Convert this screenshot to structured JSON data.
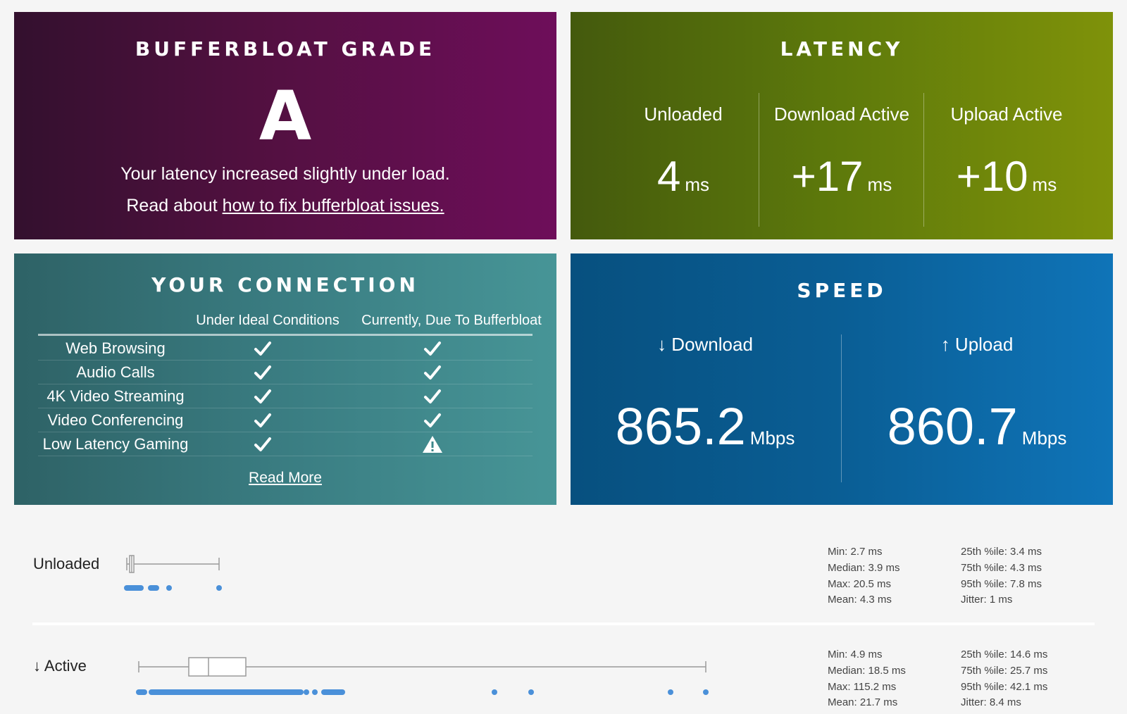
{
  "grade": {
    "title": "BUFFERBLOAT GRADE",
    "letter": "A",
    "message": "Your latency increased slightly under load.",
    "read_prefix": "Read about",
    "read_link": "how to fix bufferbloat issues."
  },
  "latency": {
    "title": "LATENCY",
    "columns": [
      {
        "label": "Unloaded",
        "value": "4",
        "unit": "ms"
      },
      {
        "label": "Download Active",
        "value": "+17",
        "unit": "ms"
      },
      {
        "label": "Upload Active",
        "value": "+10",
        "unit": "ms"
      }
    ]
  },
  "connection": {
    "title": "YOUR CONNECTION",
    "col_ideal": "Under Ideal Conditions",
    "col_current": "Currently, Due To Bufferbloat",
    "rows": [
      {
        "name": "Web Browsing",
        "ideal": "check",
        "current": "check"
      },
      {
        "name": "Audio Calls",
        "ideal": "check",
        "current": "check"
      },
      {
        "name": "4K Video Streaming",
        "ideal": "check",
        "current": "check"
      },
      {
        "name": "Video Conferencing",
        "ideal": "check",
        "current": "check"
      },
      {
        "name": "Low Latency Gaming",
        "ideal": "check",
        "current": "warning"
      }
    ],
    "read_more": "Read More"
  },
  "speed": {
    "title": "SPEED",
    "download": {
      "label": "↓ Download",
      "value": "865.2",
      "unit": "Mbps"
    },
    "upload": {
      "label": "↑ Upload",
      "value": "860.7",
      "unit": "Mbps"
    }
  },
  "latency_stats": {
    "unloaded": {
      "label": "Unloaded",
      "min": "Min: 2.7 ms",
      "median": "Median: 3.9 ms",
      "max": "Max: 20.5 ms",
      "mean": "Mean: 4.3 ms",
      "p25": "25th %ile: 3.4 ms",
      "p75": "75th %ile: 4.3 ms",
      "p95": "95th %ile: 7.8 ms",
      "jitter": "Jitter: 1 ms"
    },
    "active": {
      "label": "↓ Active",
      "min": "Min: 4.9 ms",
      "median": "Median: 18.5 ms",
      "max": "Max: 115.2 ms",
      "mean": "Mean: 21.7 ms",
      "p25": "25th %ile: 14.6 ms",
      "p75": "75th %ile: 25.7 ms",
      "p95": "95th %ile: 42.1 ms",
      "jitter": "Jitter: 8.4 ms"
    }
  },
  "colors": {
    "dot": "#4a90d9",
    "whisker": "#9a9a9a"
  }
}
